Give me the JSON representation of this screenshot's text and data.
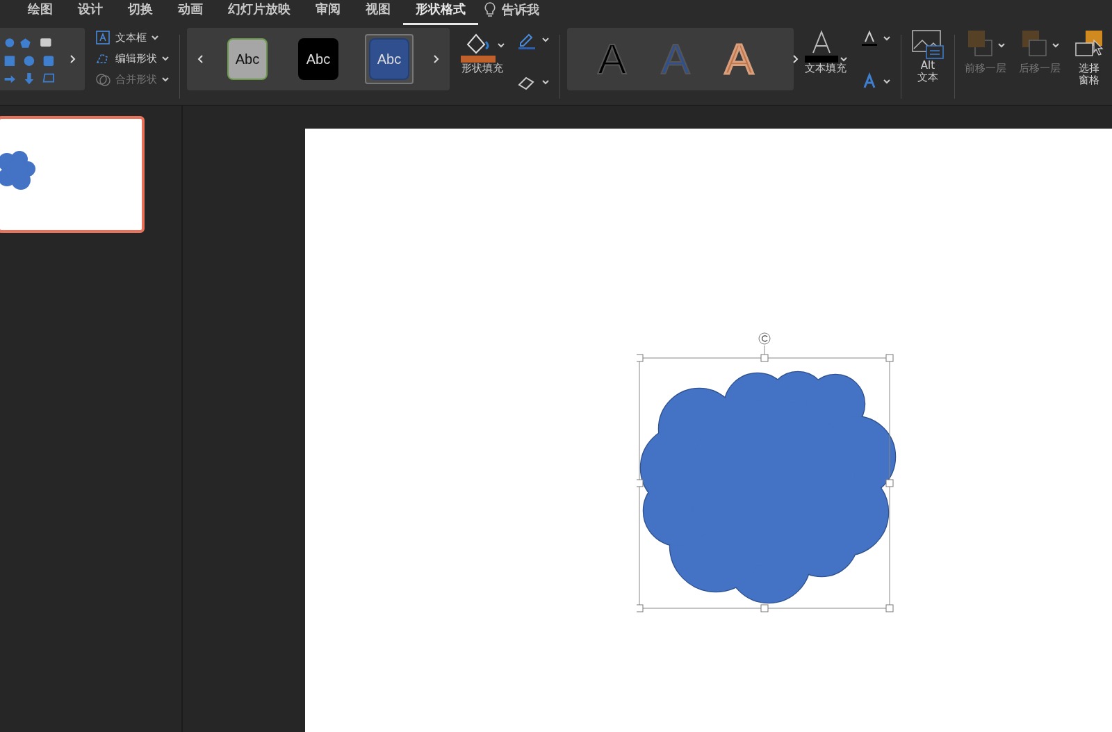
{
  "tabs": [
    {
      "label": "绘图",
      "selected": false
    },
    {
      "label": "设计",
      "selected": false
    },
    {
      "label": "切换",
      "selected": false
    },
    {
      "label": "动画",
      "selected": false
    },
    {
      "label": "幻灯片放映",
      "selected": false
    },
    {
      "label": "审阅",
      "selected": false
    },
    {
      "label": "视图",
      "selected": false
    },
    {
      "label": "形状格式",
      "selected": true
    }
  ],
  "tell_me": "告诉我",
  "ribbon": {
    "shape_commands": [
      {
        "kind": "textbox",
        "label": "文本框",
        "disabled": false
      },
      {
        "kind": "edit",
        "label": "编辑形状",
        "disabled": false
      },
      {
        "kind": "merge",
        "label": "合并形状",
        "disabled": true
      }
    ],
    "shape_styles": [
      {
        "label": "Abc",
        "color": "#a6a6a6",
        "selected": false
      },
      {
        "label": "Abc",
        "color": "#000000",
        "selected": false
      },
      {
        "label": "Abc",
        "color": "#2f4f8f",
        "selected": true
      }
    ],
    "shape_fill": "形状填充",
    "wordart_styles": [
      {
        "label": "A",
        "color": "#000000"
      },
      {
        "label": "A",
        "color": "#2f4f8f"
      },
      {
        "label": "A",
        "color": "#c0744a"
      }
    ],
    "text_fill": "文本填充",
    "alt_text": [
      "Alt",
      "文本"
    ],
    "arrange": [
      {
        "kind": "forward",
        "lines": [
          "前移一层"
        ],
        "disabled": true
      },
      {
        "kind": "backward",
        "lines": [
          "后移一层"
        ],
        "disabled": true
      },
      {
        "kind": "pane",
        "lines": [
          "选择",
          "窗格"
        ],
        "disabled": false
      }
    ]
  },
  "slides": [
    {
      "selected": true
    }
  ],
  "shape": {
    "kind": "cloud",
    "selected": true
  }
}
